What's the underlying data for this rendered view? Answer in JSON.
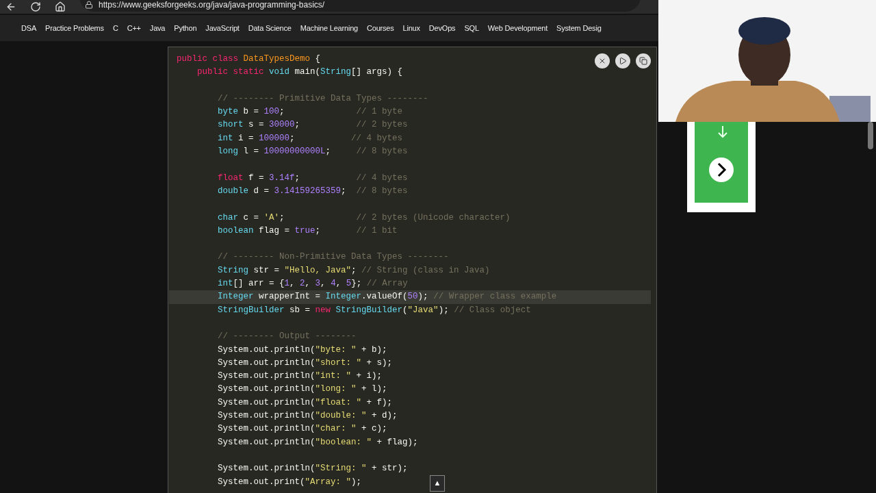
{
  "browser": {
    "url": "https://www.geeksforgeeks.org/java/java-programming-basics/"
  },
  "nav": {
    "items": [
      "DSA",
      "Practice Problems",
      "C",
      "C++",
      "Java",
      "Python",
      "JavaScript",
      "Data Science",
      "Machine Learning",
      "Courses",
      "Linux",
      "DevOps",
      "SQL",
      "Web Development",
      "System Desig"
    ]
  },
  "code": {
    "lines": [
      {
        "tokens": [
          {
            "kind": "keyword",
            "text": "public class "
          },
          {
            "kind": "class",
            "text": "DataTypesDemo"
          },
          {
            "kind": "plain",
            "text": " {"
          }
        ]
      },
      {
        "tokens": [
          {
            "kind": "keyword",
            "text": "    public static "
          },
          {
            "kind": "type",
            "text": "void"
          },
          {
            "kind": "plain",
            "text": " main("
          },
          {
            "kind": "type",
            "text": "String"
          },
          {
            "kind": "plain",
            "text": "[] args) {"
          }
        ]
      },
      {
        "kind": "blank"
      },
      {
        "tokens": [
          {
            "kind": "comment",
            "text": "        // -------- Primitive Data Types --------"
          }
        ]
      },
      {
        "tokens": [
          {
            "kind": "type",
            "text": "        byte"
          },
          {
            "kind": "plain",
            "text": " b = "
          },
          {
            "kind": "number",
            "text": "100"
          },
          {
            "kind": "plain",
            "text": ";              "
          },
          {
            "kind": "comment",
            "text": "// 1 byte"
          }
        ]
      },
      {
        "tokens": [
          {
            "kind": "type",
            "text": "        short"
          },
          {
            "kind": "plain",
            "text": " s = "
          },
          {
            "kind": "number",
            "text": "30000"
          },
          {
            "kind": "plain",
            "text": ";           "
          },
          {
            "kind": "comment",
            "text": "// 2 bytes"
          }
        ]
      },
      {
        "tokens": [
          {
            "kind": "type",
            "text": "        int"
          },
          {
            "kind": "plain",
            "text": " i = "
          },
          {
            "kind": "number",
            "text": "100000"
          },
          {
            "kind": "plain",
            "text": ";           "
          },
          {
            "kind": "comment",
            "text": "// 4 bytes"
          }
        ]
      },
      {
        "tokens": [
          {
            "kind": "type",
            "text": "        long"
          },
          {
            "kind": "plain",
            "text": " l = "
          },
          {
            "kind": "number",
            "text": "10000000000L"
          },
          {
            "kind": "plain",
            "text": ";     "
          },
          {
            "kind": "comment",
            "text": "// 8 bytes"
          }
        ]
      },
      {
        "kind": "blank"
      },
      {
        "tokens": [
          {
            "kind": "keyword",
            "text": "        float"
          },
          {
            "kind": "plain",
            "text": " f = "
          },
          {
            "kind": "number",
            "text": "3.14f"
          },
          {
            "kind": "plain",
            "text": ";           "
          },
          {
            "kind": "comment",
            "text": "// 4 bytes"
          }
        ]
      },
      {
        "tokens": [
          {
            "kind": "type",
            "text": "        double"
          },
          {
            "kind": "plain",
            "text": " d = "
          },
          {
            "kind": "number",
            "text": "3.14159265359"
          },
          {
            "kind": "plain",
            "text": ";  "
          },
          {
            "kind": "comment",
            "text": "// 8 bytes"
          }
        ]
      },
      {
        "kind": "blank"
      },
      {
        "tokens": [
          {
            "kind": "type",
            "text": "        char"
          },
          {
            "kind": "plain",
            "text": " c = "
          },
          {
            "kind": "string",
            "text": "'A'"
          },
          {
            "kind": "plain",
            "text": ";              "
          },
          {
            "kind": "comment",
            "text": "// 2 bytes (Unicode character)"
          }
        ]
      },
      {
        "tokens": [
          {
            "kind": "type",
            "text": "        boolean"
          },
          {
            "kind": "plain",
            "text": " flag = "
          },
          {
            "kind": "number",
            "text": "true"
          },
          {
            "kind": "plain",
            "text": ";       "
          },
          {
            "kind": "comment",
            "text": "// 1 bit"
          }
        ]
      },
      {
        "kind": "blank"
      },
      {
        "tokens": [
          {
            "kind": "comment",
            "text": "        // -------- Non-Primitive Data Types --------"
          }
        ]
      },
      {
        "tokens": [
          {
            "kind": "type",
            "text": "        String"
          },
          {
            "kind": "plain",
            "text": " str = "
          },
          {
            "kind": "string",
            "text": "\"Hello, Java\""
          },
          {
            "kind": "plain",
            "text": "; "
          },
          {
            "kind": "comment",
            "text": "// String (class in Java)"
          }
        ]
      },
      {
        "tokens": [
          {
            "kind": "type",
            "text": "        int"
          },
          {
            "kind": "plain",
            "text": "[] arr = {"
          },
          {
            "kind": "number",
            "text": "1"
          },
          {
            "kind": "plain",
            "text": ", "
          },
          {
            "kind": "number",
            "text": "2"
          },
          {
            "kind": "plain",
            "text": ", "
          },
          {
            "kind": "number",
            "text": "3"
          },
          {
            "kind": "plain",
            "text": ", "
          },
          {
            "kind": "number",
            "text": "4"
          },
          {
            "kind": "plain",
            "text": ", "
          },
          {
            "kind": "number",
            "text": "5"
          },
          {
            "kind": "plain",
            "text": "}; "
          },
          {
            "kind": "comment",
            "text": "// Array"
          }
        ]
      },
      {
        "highlighted": true,
        "tokens": [
          {
            "kind": "type",
            "text": "        Integer"
          },
          {
            "kind": "plain",
            "text": " wrapperInt = "
          },
          {
            "kind": "type",
            "text": "Integer"
          },
          {
            "kind": "plain",
            "text": ".valueOf("
          },
          {
            "kind": "number",
            "text": "50"
          },
          {
            "kind": "plain",
            "text": "); "
          },
          {
            "kind": "comment",
            "text": "// Wrapper class example"
          }
        ]
      },
      {
        "tokens": [
          {
            "kind": "type",
            "text": "        StringBuilder"
          },
          {
            "kind": "plain",
            "text": " sb = "
          },
          {
            "kind": "keyword",
            "text": "new "
          },
          {
            "kind": "type",
            "text": "StringBuilder"
          },
          {
            "kind": "plain",
            "text": "("
          },
          {
            "kind": "string",
            "text": "\"Java\""
          },
          {
            "kind": "plain",
            "text": "); "
          },
          {
            "kind": "comment",
            "text": "// Class object"
          }
        ]
      },
      {
        "kind": "blank"
      },
      {
        "tokens": [
          {
            "kind": "comment",
            "text": "        // -------- Output --------"
          }
        ]
      },
      {
        "tokens": [
          {
            "kind": "plain",
            "text": "        System.out.println("
          },
          {
            "kind": "string",
            "text": "\"byte: \""
          },
          {
            "kind": "plain",
            "text": " + b);"
          }
        ]
      },
      {
        "tokens": [
          {
            "kind": "plain",
            "text": "        System.out.println("
          },
          {
            "kind": "string",
            "text": "\"short: \""
          },
          {
            "kind": "plain",
            "text": " + s);"
          }
        ]
      },
      {
        "tokens": [
          {
            "kind": "plain",
            "text": "        System.out.println("
          },
          {
            "kind": "string",
            "text": "\"int: \""
          },
          {
            "kind": "plain",
            "text": " + i);"
          }
        ]
      },
      {
        "tokens": [
          {
            "kind": "plain",
            "text": "        System.out.println("
          },
          {
            "kind": "string",
            "text": "\"long: \""
          },
          {
            "kind": "plain",
            "text": " + l);"
          }
        ]
      },
      {
        "tokens": [
          {
            "kind": "plain",
            "text": "        System.out.println("
          },
          {
            "kind": "string",
            "text": "\"float: \""
          },
          {
            "kind": "plain",
            "text": " + f);"
          }
        ]
      },
      {
        "tokens": [
          {
            "kind": "plain",
            "text": "        System.out.println("
          },
          {
            "kind": "string",
            "text": "\"double: \""
          },
          {
            "kind": "plain",
            "text": " + d);"
          }
        ]
      },
      {
        "tokens": [
          {
            "kind": "plain",
            "text": "        System.out.println("
          },
          {
            "kind": "string",
            "text": "\"char: \""
          },
          {
            "kind": "plain",
            "text": " + c);"
          }
        ]
      },
      {
        "tokens": [
          {
            "kind": "plain",
            "text": "        System.out.println("
          },
          {
            "kind": "string",
            "text": "\"boolean: \""
          },
          {
            "kind": "plain",
            "text": " + flag);"
          }
        ]
      },
      {
        "kind": "blank"
      },
      {
        "tokens": [
          {
            "kind": "plain",
            "text": "        System.out.println("
          },
          {
            "kind": "string",
            "text": "\"String: \""
          },
          {
            "kind": "plain",
            "text": " + str);"
          }
        ]
      },
      {
        "tokens": [
          {
            "kind": "plain",
            "text": "        System.out.print("
          },
          {
            "kind": "string",
            "text": "\"Array: \""
          },
          {
            "kind": "plain",
            "text": ");"
          }
        ]
      }
    ]
  },
  "scroll_top": {
    "label": "▲"
  }
}
